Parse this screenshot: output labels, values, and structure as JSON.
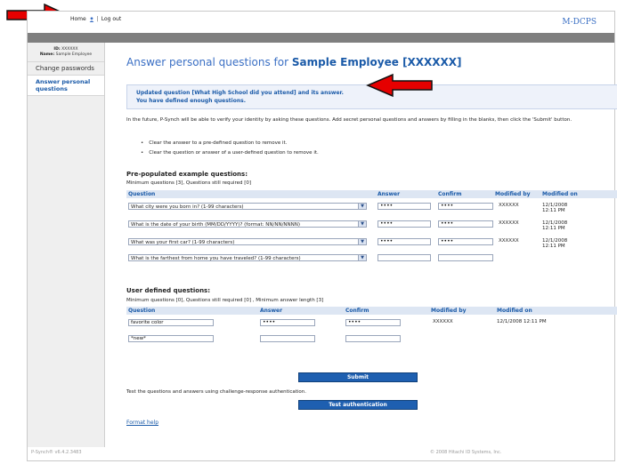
{
  "header": {
    "home_label": "Home",
    "separator": "|",
    "logout_label": "Log out",
    "logo": "M-DCPS"
  },
  "sidebar": {
    "id_label": "ID:",
    "id_value": "XXXXXX",
    "name_label": "Name:",
    "name_value": "Sample Employee",
    "items": [
      {
        "label": "Change passwords"
      },
      {
        "label": "Answer personal questions",
        "active": true
      }
    ]
  },
  "main": {
    "title_prefix": "Answer personal questions for ",
    "title_employee": "Sample Employee [XXXXXX]",
    "notice_line1": "Updated question [What High School did you attend] and its answer.",
    "notice_line2": "You have defined enough questions.",
    "intro": "In the future, P-Synch will be able to verify your identity by asking these questions. Add secret personal questions and answers by filling in the blanks, then click the 'Submit' button.",
    "bullets": [
      "Clear the answer to a pre-defined question to remove it.",
      "Clear the question or answer of a user-defined question to remove it."
    ]
  },
  "prepopulated": {
    "title": "Pre-populated example questions:",
    "subtitle": "Minimum questions [3], Questions still required [0]",
    "columns": [
      "Question",
      "Answer",
      "Confirm",
      "Modified by",
      "Modified on"
    ],
    "rows": [
      {
        "question": "What city were you born in? (1-99 characters)",
        "answer": "••••",
        "confirm": "••••",
        "modified_by": "XXXXXX",
        "modified_on": "12/1/2008 12:11 PM"
      },
      {
        "question": "What is the date of your birth (MM/DD/YYYY)? (format: NN/NN/NNNN)",
        "answer": "••••",
        "confirm": "••••",
        "modified_by": "XXXXXX",
        "modified_on": "12/1/2008 12:11 PM"
      },
      {
        "question": "What was your first car? (1-99 characters)",
        "answer": "••••",
        "confirm": "••••",
        "modified_by": "XXXXXX",
        "modified_on": "12/1/2008 12:11 PM"
      },
      {
        "question": "What is the farthest from home you have traveled? (1-99 characters)",
        "answer": "",
        "confirm": "",
        "modified_by": "",
        "modified_on": ""
      }
    ]
  },
  "user_defined": {
    "title": "User defined questions:",
    "subtitle": "Minimum questions [0], Questions still required [0] , Minimum answer length [3]",
    "columns": [
      "Question",
      "Answer",
      "Confirm",
      "Modified by",
      "Modified on"
    ],
    "rows": [
      {
        "question": "favorite color",
        "answer": "••••",
        "confirm": "••••",
        "modified_by": "XXXXXX",
        "modified_on": "12/1/2008 12:11 PM"
      },
      {
        "question": "*new*",
        "answer": "",
        "confirm": "",
        "modified_by": "",
        "modified_on": ""
      }
    ]
  },
  "actions": {
    "submit_label": "Submit",
    "test_text": "Test the questions and answers using challenge-response authentication.",
    "test_button_label": "Test authentication",
    "format_help": "Format help"
  },
  "footer": {
    "version": "P-Synch® v6.4.2.3483",
    "copyright": "© 2008 Hitachi ID Systems, Inc."
  },
  "colors": {
    "accent": "#1a5aa8",
    "button": "#1e5fb0",
    "arrow": "#e60000"
  }
}
